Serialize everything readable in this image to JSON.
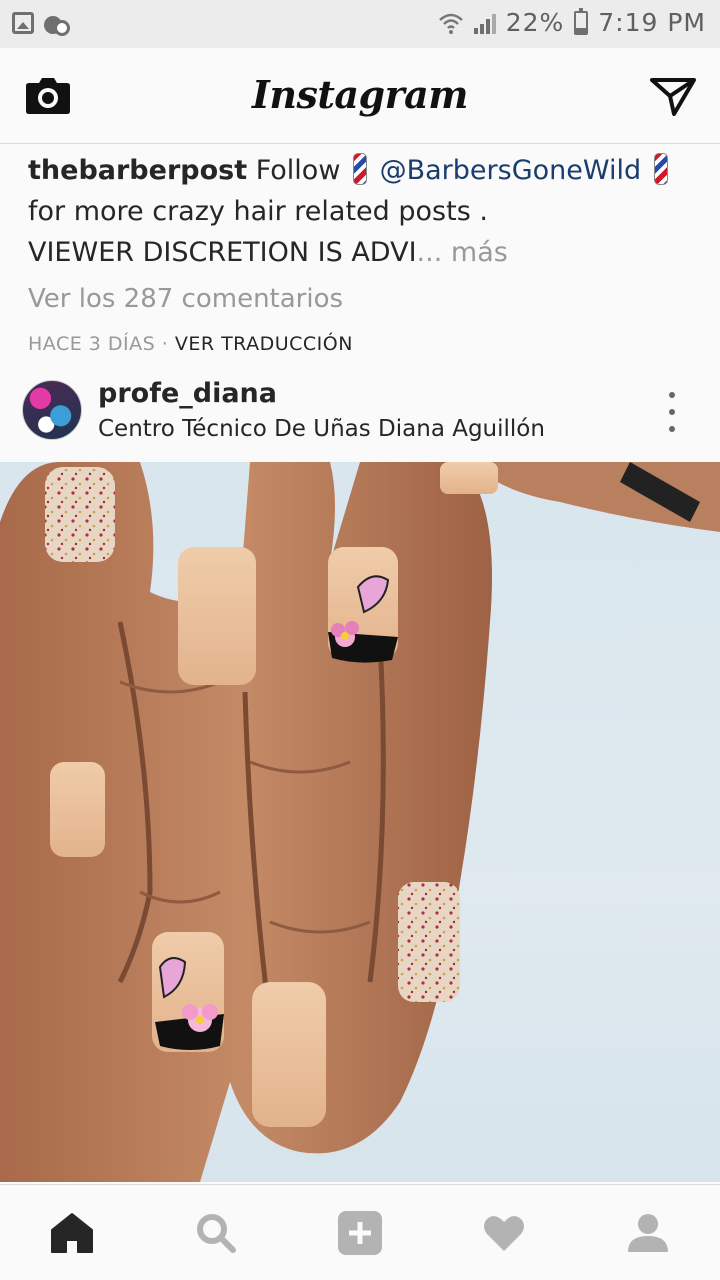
{
  "status_bar": {
    "battery": "22%",
    "battery_level": 0.22,
    "time": "7:19 PM"
  },
  "header": {
    "brand": "Instagram",
    "camera_icon": "camera-icon",
    "direct_icon": "paper-plane-icon"
  },
  "caption": {
    "username": "thebarberpost",
    "follow_text": "Follow",
    "mention": "@BarbersGoneWild",
    "text_after_mention": "for more crazy hair related posts .",
    "line3": "VIEWER DISCRETION IS ADVI",
    "ellipsis": "...",
    "more_label": "más",
    "emoji_icon": "barber-pole-icon"
  },
  "comments": {
    "view_all_label": "Ver los 287 comentarios"
  },
  "meta": {
    "time_ago": "HACE 3 DÍAS",
    "separator": "·",
    "translate_label": "VER TRADUCCIÓN"
  },
  "post": {
    "username": "profe_diana",
    "location": "Centro Técnico De Uñas Diana Aguillón",
    "image_subject": "hand with nude manicure and butterfly-flower nail art"
  },
  "nav": {
    "items": [
      "home-icon",
      "search-icon",
      "add-post-icon",
      "activity-heart-icon",
      "profile-icon"
    ],
    "active": "home-icon"
  },
  "colors": {
    "accent_mention": "#1a3d6d",
    "muted_text": "#999999",
    "nav_active": "#262626",
    "nav_inactive": "#b3b3b3"
  }
}
